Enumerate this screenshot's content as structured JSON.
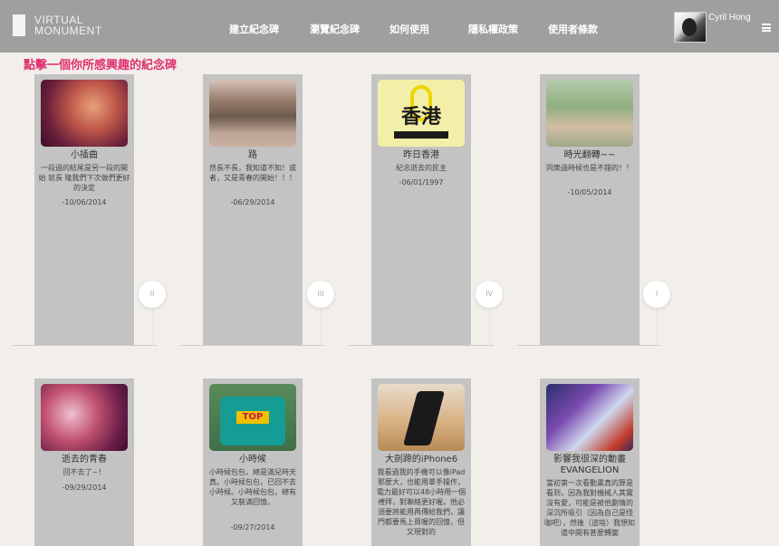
{
  "brand": {
    "line1": "VIRTUAL",
    "line2": "MONUMENT"
  },
  "nav": [
    "建立紀念碑",
    "瀏覽紀念碑",
    "如何使用",
    "隱私權政策",
    "使用者條款"
  ],
  "user": {
    "name": "Cyril Hong"
  },
  "heading": "點擊一個你所感興趣的紀念碑",
  "cards": [
    {
      "name": "小插曲",
      "desc": "一段過的結尾是另一段的開始 就長 隆我們下次做們更好的決定",
      "date": "-10/06/2014"
    },
    {
      "name": "路",
      "desc": "然長不長，我知道不知！或者，又是青春的開始！！！",
      "date": "-06/29/2014"
    },
    {
      "name": "昨日香港",
      "desc": "紀念逝去的民主",
      "date": "-06/01/1997"
    },
    {
      "name": "時光翻轉~~",
      "desc": "同樂過時候也是不錯的！！",
      "date": "-10/05/2014"
    },
    {
      "name": "逝去的青春",
      "desc": "回不去了~！",
      "date": "-09/29/2014"
    },
    {
      "name": "小時候",
      "desc": "小時候包包，總是滿兒時天真。小時候包包，已回不去小時候。小時候包包，總有又裝滿回憶。",
      "date": "-09/27/2014"
    },
    {
      "name": "大劍蹄的iPhone6",
      "desc": "我看過我的手機可以像iPad那麼大，也能用單手操作，電力最好可以48小時用一個禮拜，對聯絡更好喔。他必須要將能用再傳給我們，讓門都要馬上買喔的回憶，但又現對的",
      "date": ""
    },
    {
      "name": "影響我很深的動畫 EVANGELION",
      "desc": "當初第一次看動畫真的算是看到，因為我對機械人其實沒有愛，可能是被他劇情的深沉所吸引（因為自己是怪咖吧），然後（這啥）我想知道中間有甚麼轉變",
      "date": ""
    }
  ],
  "page_markers": [
    "II",
    "III",
    "IV",
    "I"
  ],
  "colors": {
    "topbar": "#9f9f9f",
    "background": "#f2efea",
    "card": "#c3c3c3",
    "heading": "#e0306f"
  }
}
